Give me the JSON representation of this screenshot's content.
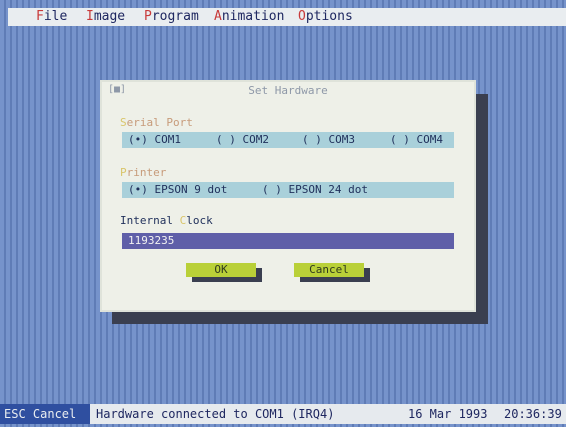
{
  "menubar": {
    "items": [
      {
        "label": "File",
        "hotkey": "F",
        "rest": "ile"
      },
      {
        "label": "Image",
        "hotkey": "I",
        "rest": "mage"
      },
      {
        "label": "Program",
        "hotkey": "P",
        "rest": "rogram"
      },
      {
        "label": "Animation",
        "hotkey": "A",
        "rest": "nimation"
      },
      {
        "label": "Options",
        "hotkey": "O",
        "rest": "ptions"
      }
    ]
  },
  "dialog": {
    "title": "Set Hardware",
    "close_glyph": "[■]",
    "serial_port": {
      "label_first": "S",
      "label_rest": "erial Port",
      "options": [
        {
          "marker": "(•)",
          "name": "COM1"
        },
        {
          "marker": "( )",
          "name": "COM2"
        },
        {
          "marker": "( )",
          "name": "COM3"
        },
        {
          "marker": "( )",
          "name": "COM4"
        }
      ]
    },
    "printer": {
      "label_first": "P",
      "label_rest": "rinter",
      "options": [
        {
          "marker": "(•)",
          "name": "EPSON 9 dot"
        },
        {
          "marker": "( )",
          "name": "EPSON 24 dot"
        }
      ]
    },
    "internal_clock": {
      "label_first": "Internal ",
      "label_hot": "C",
      "label_rest": "lock",
      "value": "1193235"
    },
    "buttons": {
      "ok": "OK",
      "cancel": "Cancel"
    }
  },
  "statusbar": {
    "esc": "ESC Cancel",
    "message": "Hardware connected to COM1 (IRQ4)",
    "date": "16 Mar 1993",
    "time": "20:36:39"
  },
  "colors": {
    "desktop": "#6f8cc4",
    "dialog": "#eef0e8",
    "option_strip": "#a9d0da",
    "clock_input": "#5f5fa8",
    "button": "#b9d038"
  }
}
